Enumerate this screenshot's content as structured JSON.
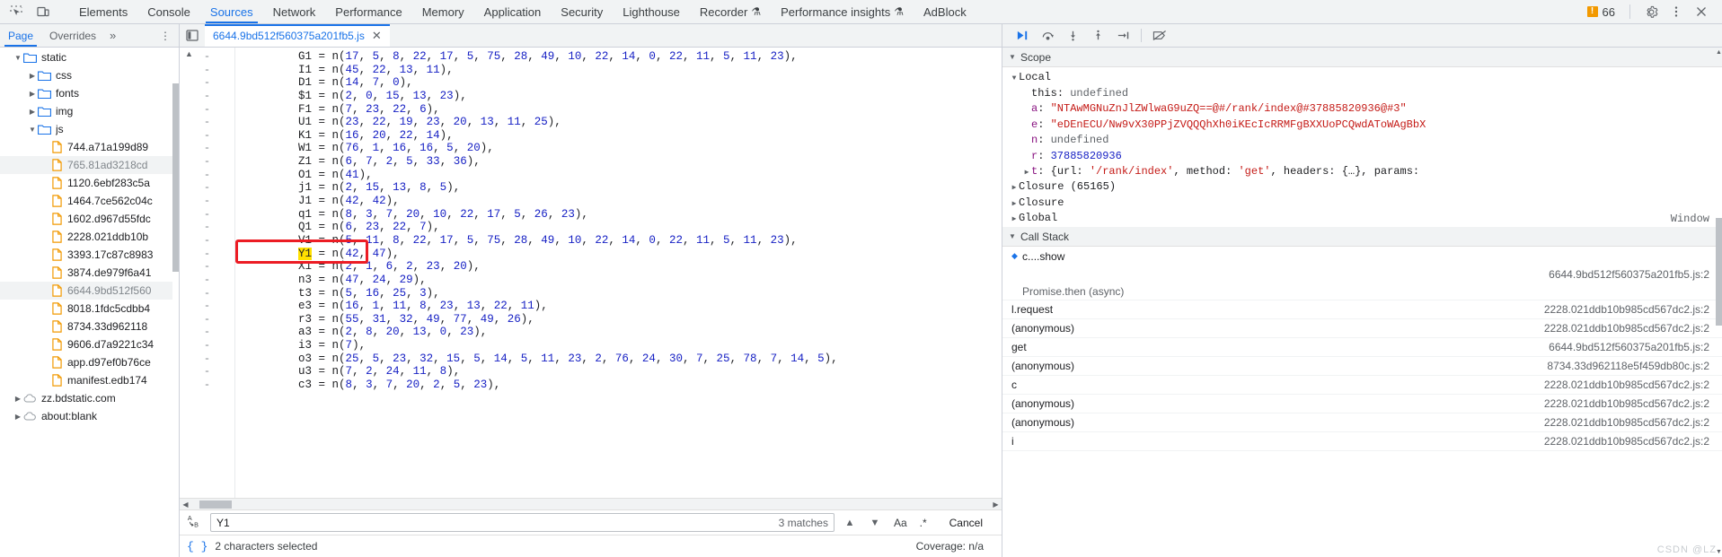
{
  "toolbar": {
    "inspect_icon": "inspect-element-icon",
    "device_icon": "device-toolbar-icon",
    "tabs": [
      {
        "label": "Elements",
        "active": false,
        "flask": false
      },
      {
        "label": "Console",
        "active": false,
        "flask": false
      },
      {
        "label": "Sources",
        "active": true,
        "flask": false
      },
      {
        "label": "Network",
        "active": false,
        "flask": false
      },
      {
        "label": "Performance",
        "active": false,
        "flask": false
      },
      {
        "label": "Memory",
        "active": false,
        "flask": false
      },
      {
        "label": "Application",
        "active": false,
        "flask": false
      },
      {
        "label": "Security",
        "active": false,
        "flask": false
      },
      {
        "label": "Lighthouse",
        "active": false,
        "flask": false
      },
      {
        "label": "Recorder",
        "active": false,
        "flask": true
      },
      {
        "label": "Performance insights",
        "active": false,
        "flask": true
      },
      {
        "label": "AdBlock",
        "active": false,
        "flask": false
      }
    ],
    "warning_mark": "!",
    "warning_count": "66",
    "settings_icon": "gear-icon",
    "more_icon": "kebab-menu-icon",
    "close_icon": "close-icon",
    "accent_color": "#1a73e8",
    "warning_color": "#f29900"
  },
  "navpane": {
    "subtabs": [
      {
        "label": "Page",
        "active": true
      },
      {
        "label": "Overrides",
        "active": false
      }
    ],
    "more_chevrons": "»",
    "kebab": "⋮",
    "tree": [
      {
        "label": "static",
        "depth": 1,
        "type": "folder",
        "expanded": true,
        "selected": false
      },
      {
        "label": "css",
        "depth": 2,
        "type": "folder",
        "expanded": false,
        "selected": false
      },
      {
        "label": "fonts",
        "depth": 2,
        "type": "folder",
        "expanded": false,
        "selected": false
      },
      {
        "label": "img",
        "depth": 2,
        "type": "folder",
        "expanded": false,
        "selected": false
      },
      {
        "label": "js",
        "depth": 2,
        "type": "folder",
        "expanded": true,
        "selected": false
      },
      {
        "label": "744.a71a199d89",
        "depth": 3,
        "type": "file",
        "selected": false
      },
      {
        "label": "765.81ad3218cd",
        "depth": 3,
        "type": "file",
        "selected": true
      },
      {
        "label": "1120.6ebf283c5a",
        "depth": 3,
        "type": "file",
        "selected": false
      },
      {
        "label": "1464.7ce562c04c",
        "depth": 3,
        "type": "file",
        "selected": false
      },
      {
        "label": "1602.d967d55fdc",
        "depth": 3,
        "type": "file",
        "selected": false
      },
      {
        "label": "2228.021ddb10b",
        "depth": 3,
        "type": "file",
        "selected": false
      },
      {
        "label": "3393.17c87c8983",
        "depth": 3,
        "type": "file",
        "selected": false
      },
      {
        "label": "3874.de979f6a41",
        "depth": 3,
        "type": "file",
        "selected": false
      },
      {
        "label": "6644.9bd512f560",
        "depth": 3,
        "type": "file",
        "selected": true
      },
      {
        "label": "8018.1fdc5cdbb4",
        "depth": 3,
        "type": "file",
        "selected": false
      },
      {
        "label": "8734.33d962118",
        "depth": 3,
        "type": "file",
        "selected": false
      },
      {
        "label": "9606.d7a9221c34",
        "depth": 3,
        "type": "file",
        "selected": false
      },
      {
        "label": "app.d97ef0b76ce",
        "depth": 3,
        "type": "file",
        "selected": false
      },
      {
        "label": "manifest.edb174",
        "depth": 3,
        "type": "file",
        "selected": false
      },
      {
        "label": "zz.bdstatic.com",
        "depth": 1,
        "type": "cloud",
        "expanded": false,
        "selected": false
      },
      {
        "label": "about:blank",
        "depth": 1,
        "type": "cloud",
        "expanded": false,
        "selected": false
      }
    ]
  },
  "editor": {
    "panel_toggle_icon": "show-navigator-icon",
    "file_tab": {
      "label": "6644.9bd512f560375a201fb5.js",
      "close_icon": "close-tab-icon"
    },
    "gutter_marker": "-",
    "lines": [
      {
        "name": "G1",
        "args": "17, 5, 8, 22, 17, 5, 75, 28, 49, 10, 22, 14, 0, 22, 11, 5, 11, 23",
        "highlight": false
      },
      {
        "name": "I1",
        "args": "45, 22, 13, 11",
        "highlight": false
      },
      {
        "name": "D1",
        "args": "14, 7, 0",
        "highlight": false
      },
      {
        "name": "$1",
        "args": "2, 0, 15, 13, 23",
        "highlight": false
      },
      {
        "name": "F1",
        "args": "7, 23, 22, 6",
        "highlight": false
      },
      {
        "name": "U1",
        "args": "23, 22, 19, 23, 20, 13, 11, 25",
        "highlight": false
      },
      {
        "name": "K1",
        "args": "16, 20, 22, 14",
        "highlight": false
      },
      {
        "name": "W1",
        "args": "76, 1, 16, 16, 5, 20",
        "highlight": false
      },
      {
        "name": "Z1",
        "args": "6, 7, 2, 5, 33, 36",
        "highlight": false
      },
      {
        "name": "O1",
        "args": "41",
        "highlight": false
      },
      {
        "name": "j1",
        "args": "2, 15, 13, 8, 5",
        "highlight": false
      },
      {
        "name": "J1",
        "args": "42, 42",
        "highlight": false
      },
      {
        "name": "q1",
        "args": "8, 3, 7, 20, 10, 22, 17, 5, 26, 23",
        "highlight": false
      },
      {
        "name": "Q1",
        "args": "6, 23, 22, 7",
        "highlight": false
      },
      {
        "name": "V1",
        "args": "5, 11, 8, 22, 17, 5, 75, 28, 49, 10, 22, 14, 0, 22, 11, 5, 11, 23",
        "highlight": false
      },
      {
        "name": "Y1",
        "args": "42, 47",
        "highlight": true
      },
      {
        "name": "X1",
        "args": "2, 1, 6, 2, 23, 20",
        "highlight": false
      },
      {
        "name": "n3",
        "args": "47, 24, 29",
        "highlight": false
      },
      {
        "name": "t3",
        "args": "5, 16, 25, 3",
        "highlight": false
      },
      {
        "name": "e3",
        "args": "16, 1, 11, 8, 23, 13, 22, 11",
        "highlight": false
      },
      {
        "name": "r3",
        "args": "55, 31, 32, 49, 77, 49, 26",
        "highlight": false
      },
      {
        "name": "a3",
        "args": "2, 8, 20, 13, 0, 23",
        "highlight": false
      },
      {
        "name": "i3",
        "args": "7",
        "highlight": false
      },
      {
        "name": "o3",
        "args": "25, 5, 23, 32, 15, 5, 14, 5, 11, 23, 2, 76, 24, 30, 7, 25, 78, 7, 14, 5",
        "highlight": false
      },
      {
        "name": "u3",
        "args": "7, 2, 24, 11, 8",
        "highlight": false
      },
      {
        "name": "c3",
        "args": "8, 3, 7, 20, 2, 5, 23",
        "highlight": false
      }
    ]
  },
  "search": {
    "icon": "case-replace-icon",
    "value": "Y1",
    "placeholder": "Find",
    "matches_label": "3 matches",
    "prev_icon": "chevron-up-icon",
    "next_icon": "chevron-down-icon",
    "match_case_label": "Aa",
    "regex_label": ".*",
    "cancel_label": "Cancel"
  },
  "statusbar": {
    "format_icon": "pretty-print-braces-icon",
    "selection_text": "2 characters selected",
    "coverage_text": "Coverage: n/a"
  },
  "debugger": {
    "toolbar_buttons": [
      {
        "name": "resume-script-execution",
        "glyph": "▶",
        "accent": true
      },
      {
        "name": "step-over-next-function-call",
        "glyph": "↷",
        "accent": false
      },
      {
        "name": "step-into-next-function-call",
        "glyph": "↓",
        "accent": false
      },
      {
        "name": "step-out-of-current-function",
        "glyph": "↑",
        "accent": false
      },
      {
        "name": "step",
        "glyph": "→|",
        "accent": false
      },
      {
        "name": "deactivate-breakpoints",
        "glyph": "⦸",
        "accent": false
      }
    ],
    "scope": {
      "title": "Scope",
      "local_title": "Local",
      "entries": [
        {
          "key": "this",
          "sep": ": ",
          "value": "undefined",
          "vtype": "undef",
          "key_style": "plain",
          "expandable": false
        },
        {
          "key": "a",
          "sep": ": ",
          "value": "\"NTAwMGNuZnJlZWlwaG9uZQ==@#/rank/index@#37885820936@#3\"",
          "vtype": "str",
          "key_style": "prop",
          "expandable": false
        },
        {
          "key": "e",
          "sep": ": ",
          "value": "\"eDEnECU/Nw9vX30PPjZVQQQhXh0iKEcIcRRMFgBXXUoPCQwdAToWAgBbX",
          "vtype": "str",
          "key_style": "prop",
          "expandable": false
        },
        {
          "key": "n",
          "sep": ": ",
          "value": "undefined",
          "vtype": "undef",
          "key_style": "prop",
          "expandable": false
        },
        {
          "key": "r",
          "sep": ": ",
          "value": "37885820936",
          "vtype": "num",
          "key_style": "prop",
          "expandable": false
        },
        {
          "key": "t",
          "sep": ": ",
          "value": "{url: '/rank/index', method: 'get', headers: {…}, params:",
          "vtype": "obj",
          "key_style": "prop",
          "expandable": true
        }
      ],
      "closures": [
        {
          "label": "Closure (65165)",
          "right": ""
        },
        {
          "label": "Closure",
          "right": ""
        },
        {
          "label": "Global",
          "right": "Window"
        }
      ]
    },
    "callstack": {
      "title": "Call Stack",
      "current_frame": "c.<computed>.<computed>.<computed>.show",
      "current_frame_loc": "6644.9bd512f560375a201fb5.js:2",
      "async_label": "Promise.then (async)",
      "frames": [
        {
          "name": "l.request",
          "loc": "2228.021ddb10b985cd567dc2.js:2"
        },
        {
          "name": "(anonymous)",
          "loc": "2228.021ddb10b985cd567dc2.js:2"
        },
        {
          "name": "get",
          "loc": "6644.9bd512f560375a201fb5.js:2"
        },
        {
          "name": "(anonymous)",
          "loc": "8734.33d962118e5f459db80c.js:2"
        },
        {
          "name": "c",
          "loc": "2228.021ddb10b985cd567dc2.js:2"
        },
        {
          "name": "(anonymous)",
          "loc": "2228.021ddb10b985cd567dc2.js:2"
        },
        {
          "name": "(anonymous)",
          "loc": "2228.021ddb10b985cd567dc2.js:2"
        },
        {
          "name": "i",
          "loc": "2228.021ddb10b985cd567dc2.js:2"
        }
      ]
    }
  },
  "watermark": "CSDN @LZ"
}
